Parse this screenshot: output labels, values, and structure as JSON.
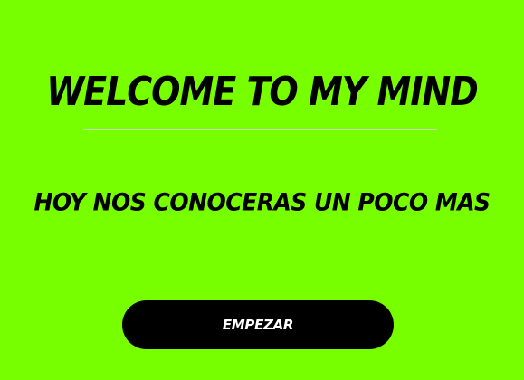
{
  "page": {
    "background_color": "#77ff00"
  },
  "hero": {
    "title": "WELCOME TO MY MIND",
    "subtitle": "HOY NOS CONOCERAS UN POCO MAS"
  },
  "actions": {
    "start_label": "EMPEZAR"
  }
}
